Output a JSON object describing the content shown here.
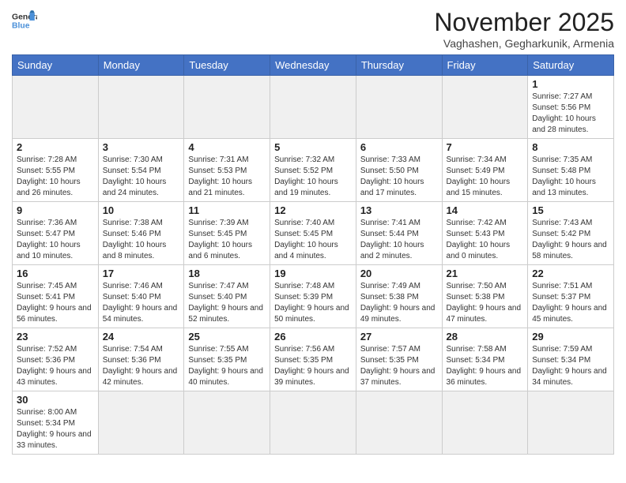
{
  "header": {
    "logo": {
      "line1": "General",
      "line2": "Blue"
    },
    "title": "November 2025",
    "subtitle": "Vaghashen, Gegharkunik, Armenia"
  },
  "weekdays": [
    "Sunday",
    "Monday",
    "Tuesday",
    "Wednesday",
    "Thursday",
    "Friday",
    "Saturday"
  ],
  "weeks": [
    [
      {
        "day": "",
        "info": ""
      },
      {
        "day": "",
        "info": ""
      },
      {
        "day": "",
        "info": ""
      },
      {
        "day": "",
        "info": ""
      },
      {
        "day": "",
        "info": ""
      },
      {
        "day": "",
        "info": ""
      },
      {
        "day": "1",
        "info": "Sunrise: 7:27 AM\nSunset: 5:56 PM\nDaylight: 10 hours and 28 minutes."
      }
    ],
    [
      {
        "day": "2",
        "info": "Sunrise: 7:28 AM\nSunset: 5:55 PM\nDaylight: 10 hours and 26 minutes."
      },
      {
        "day": "3",
        "info": "Sunrise: 7:30 AM\nSunset: 5:54 PM\nDaylight: 10 hours and 24 minutes."
      },
      {
        "day": "4",
        "info": "Sunrise: 7:31 AM\nSunset: 5:53 PM\nDaylight: 10 hours and 21 minutes."
      },
      {
        "day": "5",
        "info": "Sunrise: 7:32 AM\nSunset: 5:52 PM\nDaylight: 10 hours and 19 minutes."
      },
      {
        "day": "6",
        "info": "Sunrise: 7:33 AM\nSunset: 5:50 PM\nDaylight: 10 hours and 17 minutes."
      },
      {
        "day": "7",
        "info": "Sunrise: 7:34 AM\nSunset: 5:49 PM\nDaylight: 10 hours and 15 minutes."
      },
      {
        "day": "8",
        "info": "Sunrise: 7:35 AM\nSunset: 5:48 PM\nDaylight: 10 hours and 13 minutes."
      }
    ],
    [
      {
        "day": "9",
        "info": "Sunrise: 7:36 AM\nSunset: 5:47 PM\nDaylight: 10 hours and 10 minutes."
      },
      {
        "day": "10",
        "info": "Sunrise: 7:38 AM\nSunset: 5:46 PM\nDaylight: 10 hours and 8 minutes."
      },
      {
        "day": "11",
        "info": "Sunrise: 7:39 AM\nSunset: 5:45 PM\nDaylight: 10 hours and 6 minutes."
      },
      {
        "day": "12",
        "info": "Sunrise: 7:40 AM\nSunset: 5:45 PM\nDaylight: 10 hours and 4 minutes."
      },
      {
        "day": "13",
        "info": "Sunrise: 7:41 AM\nSunset: 5:44 PM\nDaylight: 10 hours and 2 minutes."
      },
      {
        "day": "14",
        "info": "Sunrise: 7:42 AM\nSunset: 5:43 PM\nDaylight: 10 hours and 0 minutes."
      },
      {
        "day": "15",
        "info": "Sunrise: 7:43 AM\nSunset: 5:42 PM\nDaylight: 9 hours and 58 minutes."
      }
    ],
    [
      {
        "day": "16",
        "info": "Sunrise: 7:45 AM\nSunset: 5:41 PM\nDaylight: 9 hours and 56 minutes."
      },
      {
        "day": "17",
        "info": "Sunrise: 7:46 AM\nSunset: 5:40 PM\nDaylight: 9 hours and 54 minutes."
      },
      {
        "day": "18",
        "info": "Sunrise: 7:47 AM\nSunset: 5:40 PM\nDaylight: 9 hours and 52 minutes."
      },
      {
        "day": "19",
        "info": "Sunrise: 7:48 AM\nSunset: 5:39 PM\nDaylight: 9 hours and 50 minutes."
      },
      {
        "day": "20",
        "info": "Sunrise: 7:49 AM\nSunset: 5:38 PM\nDaylight: 9 hours and 49 minutes."
      },
      {
        "day": "21",
        "info": "Sunrise: 7:50 AM\nSunset: 5:38 PM\nDaylight: 9 hours and 47 minutes."
      },
      {
        "day": "22",
        "info": "Sunrise: 7:51 AM\nSunset: 5:37 PM\nDaylight: 9 hours and 45 minutes."
      }
    ],
    [
      {
        "day": "23",
        "info": "Sunrise: 7:52 AM\nSunset: 5:36 PM\nDaylight: 9 hours and 43 minutes."
      },
      {
        "day": "24",
        "info": "Sunrise: 7:54 AM\nSunset: 5:36 PM\nDaylight: 9 hours and 42 minutes."
      },
      {
        "day": "25",
        "info": "Sunrise: 7:55 AM\nSunset: 5:35 PM\nDaylight: 9 hours and 40 minutes."
      },
      {
        "day": "26",
        "info": "Sunrise: 7:56 AM\nSunset: 5:35 PM\nDaylight: 9 hours and 39 minutes."
      },
      {
        "day": "27",
        "info": "Sunrise: 7:57 AM\nSunset: 5:35 PM\nDaylight: 9 hours and 37 minutes."
      },
      {
        "day": "28",
        "info": "Sunrise: 7:58 AM\nSunset: 5:34 PM\nDaylight: 9 hours and 36 minutes."
      },
      {
        "day": "29",
        "info": "Sunrise: 7:59 AM\nSunset: 5:34 PM\nDaylight: 9 hours and 34 minutes."
      }
    ],
    [
      {
        "day": "30",
        "info": "Sunrise: 8:00 AM\nSunset: 5:34 PM\nDaylight: 9 hours and 33 minutes."
      },
      {
        "day": "",
        "info": ""
      },
      {
        "day": "",
        "info": ""
      },
      {
        "day": "",
        "info": ""
      },
      {
        "day": "",
        "info": ""
      },
      {
        "day": "",
        "info": ""
      },
      {
        "day": "",
        "info": ""
      }
    ]
  ]
}
